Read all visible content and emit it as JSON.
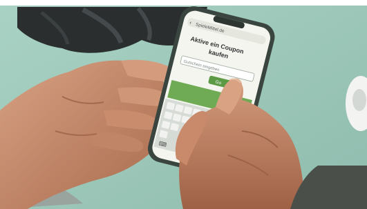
{
  "colors": {
    "table": "#9fc9bb",
    "table_shadow": "#7faea0",
    "helmet": "#2b2f30",
    "phone_body": "#3a4440",
    "screen_bg": "#f4f5ef",
    "brand_green": "#5c9a46",
    "skin": "#c98d6e",
    "skin_shadow": "#9b6448",
    "sleeve": "#4b4f4a"
  },
  "phone": {
    "url_bar": "SpieleMittel.de",
    "heading_line1": "Aktive ein Coupon",
    "heading_line2": "kaufen",
    "input_placeholder": "Gutschein eingeben",
    "submit_button": "Go"
  },
  "icons": [
    "back-arrow-icon",
    "keyboard-icon"
  ]
}
